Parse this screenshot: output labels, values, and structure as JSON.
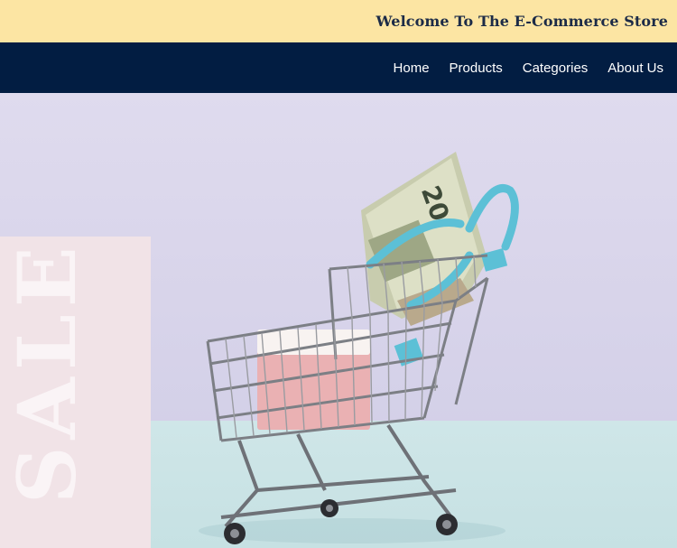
{
  "header": {
    "welcome_text": "Welcome To The E-Commerce Store"
  },
  "nav": {
    "items": [
      {
        "label": "Home"
      },
      {
        "label": "Products"
      },
      {
        "label": "Categories"
      },
      {
        "label": "About Us"
      }
    ]
  },
  "hero": {
    "sale_text": "SALE",
    "banknote_text": "20",
    "image_description_icon": "shopping-cart-with-cash"
  },
  "colors": {
    "topbar_bg": "#fce5a3",
    "navbar_bg": "#021d42",
    "heading_text": "#1c2b47",
    "clip_accent": "#5cc0d6"
  }
}
